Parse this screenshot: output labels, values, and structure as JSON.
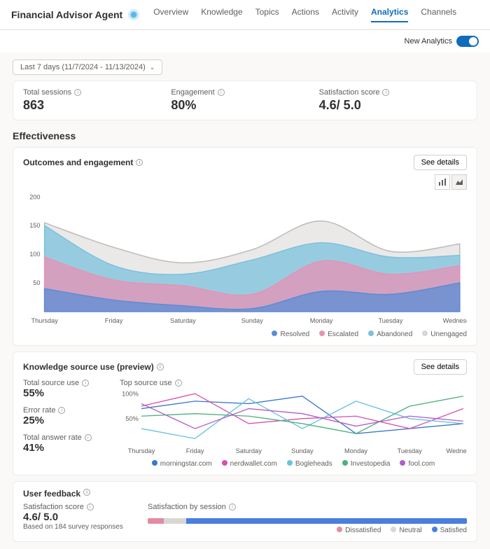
{
  "header": {
    "title": "Financial Advisor Agent",
    "tabs": [
      "Overview",
      "Knowledge",
      "Topics",
      "Actions",
      "Activity",
      "Analytics",
      "Channels"
    ],
    "active_tab": "Analytics"
  },
  "subbar": {
    "new_analytics_label": "New Analytics"
  },
  "date_range": {
    "label": "Last 7 days (11/7/2024 - 11/13/2024)"
  },
  "kpi": {
    "total_sessions": {
      "label": "Total sessions",
      "value": "863"
    },
    "engagement": {
      "label": "Engagement",
      "value": "80%"
    },
    "satisfaction": {
      "label": "Satisfaction score",
      "value": "4.6/ 5.0"
    }
  },
  "effectiveness_heading": "Effectiveness",
  "outcomes": {
    "title": "Outcomes and engagement",
    "see_details": "See details",
    "legend": {
      "resolved": "Resolved",
      "escalated": "Escalated",
      "abandoned": "Abandoned",
      "unengaged": "Unengaged"
    }
  },
  "knowledge": {
    "title": "Knowledge source use (preview)",
    "see_details": "See details",
    "total_source_use": {
      "label": "Total source use",
      "value": "55%"
    },
    "error_rate": {
      "label": "Error rate",
      "value": "25%"
    },
    "total_answer_rate": {
      "label": "Total answer rate",
      "value": "41%"
    },
    "top_source_use_label": "Top source use",
    "y_ticks": [
      "100%",
      "50%"
    ],
    "legend": [
      "morningstar.com",
      "nerdwallet.com",
      "Bogleheads",
      "Investopedia",
      "fool.com"
    ]
  },
  "feedback": {
    "title": "User feedback",
    "score_label": "Satisfaction score",
    "score_value": "4.6/ 5.0",
    "based_on": "Based on 184 survey responses",
    "session_label": "Satisfaction by session",
    "legend": {
      "dissatisfied": "Dissatisfied",
      "neutral": "Neutral",
      "satisfied": "Satisfied"
    }
  },
  "colors": {
    "resolved": "#5b8dd6",
    "escalated": "#e892b5",
    "abandoned": "#7bc1de",
    "unengaged": "#d8d7d5",
    "s1": "#3a78c9",
    "s2": "#d94fb0",
    "s3": "#67c2e0",
    "s4": "#4caf7d",
    "s5": "#b45bc9",
    "sat_dissatisfied": "#e38ba3",
    "sat_neutral": "#d8d7d5",
    "sat_satisfied": "#4a7ee0"
  },
  "chart_data": [
    {
      "type": "area",
      "title": "Outcomes and engagement",
      "categories": [
        "Thursday",
        "Friday",
        "Saturday",
        "Sunday",
        "Monday",
        "Tuesday",
        "Wednesday"
      ],
      "ylim": [
        0,
        200
      ],
      "yticks": [
        50,
        100,
        150,
        200
      ],
      "series": [
        {
          "name": "Resolved",
          "values": [
            40,
            20,
            10,
            5,
            35,
            30,
            50
          ]
        },
        {
          "name": "Escalated",
          "values": [
            95,
            55,
            45,
            30,
            88,
            65,
            80
          ]
        },
        {
          "name": "Abandoned",
          "values": [
            150,
            80,
            65,
            90,
            120,
            95,
            98
          ]
        },
        {
          "name": "Unengaged",
          "values": [
            155,
            112,
            85,
            108,
            158,
            105,
            118
          ]
        }
      ]
    },
    {
      "type": "line",
      "title": "Top source use",
      "categories": [
        "Thursday",
        "Friday",
        "Saturday",
        "Sunday",
        "Monday",
        "Tuesday",
        "Wednesday"
      ],
      "ylim": [
        0,
        100
      ],
      "yunit": "%",
      "series": [
        {
          "name": "morningstar.com",
          "values": [
            70,
            85,
            80,
            95,
            20,
            30,
            40
          ]
        },
        {
          "name": "nerdwallet.com",
          "values": [
            75,
            100,
            40,
            50,
            55,
            30,
            70
          ]
        },
        {
          "name": "Bogleheads",
          "values": [
            30,
            10,
            90,
            30,
            85,
            50,
            40
          ]
        },
        {
          "name": "Investopedia",
          "values": [
            55,
            60,
            55,
            40,
            20,
            75,
            95
          ]
        },
        {
          "name": "fool.com",
          "values": [
            80,
            30,
            70,
            60,
            35,
            55,
            45
          ]
        }
      ]
    },
    {
      "type": "bar",
      "title": "Satisfaction by session",
      "categories": [
        "Dissatisfied",
        "Neutral",
        "Satisfied"
      ],
      "values": [
        5,
        7,
        88
      ],
      "unit": "%"
    }
  ]
}
